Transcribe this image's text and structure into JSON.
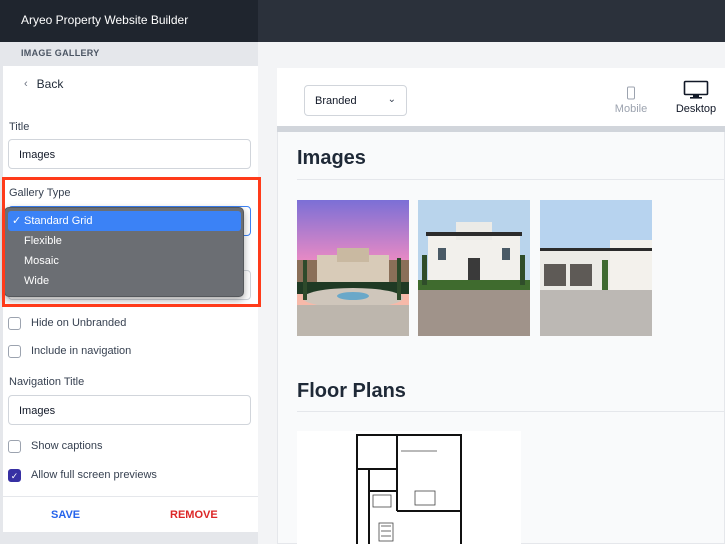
{
  "app": {
    "title": "Aryeo Property Website Builder"
  },
  "section": {
    "label": "IMAGE GALLERY"
  },
  "nav": {
    "back_label": "Back"
  },
  "form": {
    "title_label": "Title",
    "title_value": "Images",
    "gallery_type_label": "Gallery Type",
    "gallery_type_options": [
      "Standard Grid",
      "Flexible",
      "Mosaic",
      "Wide"
    ],
    "gallery_type_selected": "Standard Grid",
    "hide_unbranded_label": "Hide on Unbranded",
    "hide_unbranded_checked": false,
    "include_nav_label": "Include in navigation",
    "include_nav_checked": false,
    "nav_title_label": "Navigation Title",
    "nav_title_value": "Images",
    "show_captions_label": "Show captions",
    "show_captions_checked": false,
    "full_screen_label": "Allow full screen previews",
    "full_screen_checked": true
  },
  "actions": {
    "save_label": "SAVE",
    "remove_label": "REMOVE"
  },
  "preview": {
    "mode_value": "Branded",
    "devices": [
      {
        "label": "Mobile",
        "active": false
      },
      {
        "label": "Desktop",
        "active": true
      }
    ],
    "gallery_heading": "Images",
    "floor_heading": "Floor Plans"
  },
  "colors": {
    "accent": "#3b82f6",
    "save": "#2563eb",
    "remove": "#dc2626",
    "highlight": "#ff3b1a"
  }
}
